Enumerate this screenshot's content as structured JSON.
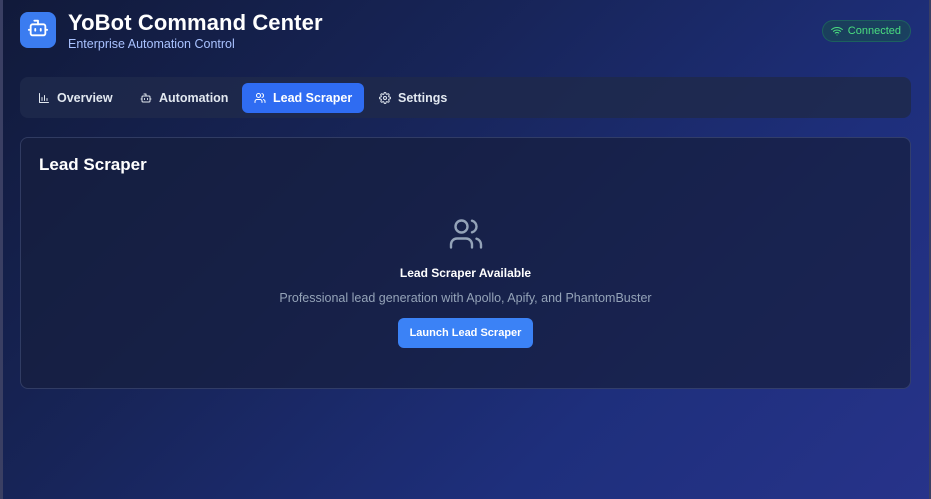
{
  "header": {
    "title": "YoBot Command Center",
    "subtitle": "Enterprise Automation Control",
    "logo_icon": "robot-icon",
    "status": {
      "label": "Connected",
      "icon": "wifi-icon",
      "color": "#4ade80"
    }
  },
  "tabs": [
    {
      "label": "Overview",
      "icon": "bar-chart-icon",
      "active": false
    },
    {
      "label": "Automation",
      "icon": "bot-icon",
      "active": false
    },
    {
      "label": "Lead Scraper",
      "icon": "users-icon",
      "active": true
    },
    {
      "label": "Settings",
      "icon": "gear-icon",
      "active": false
    }
  ],
  "panel": {
    "title": "Lead Scraper",
    "empty_state": {
      "icon": "users-icon",
      "title": "Lead Scraper Available",
      "description": "Professional lead generation with Apollo, Apify, and PhantomBuster",
      "button_label": "Launch Lead Scraper"
    }
  },
  "colors": {
    "accent": "#2f6cf2",
    "button": "#3b82f6",
    "status_green": "#4ade80"
  }
}
